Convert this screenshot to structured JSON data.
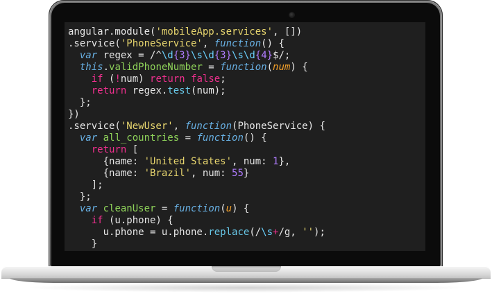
{
  "editor": {
    "lines": [
      [
        {
          "t": "angular.module(",
          "c": "default"
        },
        {
          "t": "'mobileApp.services'",
          "c": "string"
        },
        {
          "t": ", [])",
          "c": "default"
        }
      ],
      [
        {
          "t": ".service(",
          "c": "default"
        },
        {
          "t": "'PhoneService'",
          "c": "string"
        },
        {
          "t": ", ",
          "c": "default"
        },
        {
          "t": "function",
          "c": "storage"
        },
        {
          "t": "() {",
          "c": "default"
        }
      ],
      [
        {
          "t": "  ",
          "c": "default"
        },
        {
          "t": "var",
          "c": "storage"
        },
        {
          "t": " regex = /^",
          "c": "default"
        },
        {
          "t": "\\d",
          "c": "regex-escape"
        },
        {
          "t": "{3}",
          "c": "constant"
        },
        {
          "t": "\\s",
          "c": "regex-escape"
        },
        {
          "t": "\\d",
          "c": "regex-escape"
        },
        {
          "t": "{3}",
          "c": "constant"
        },
        {
          "t": "\\s",
          "c": "regex-escape"
        },
        {
          "t": "\\d",
          "c": "regex-escape"
        },
        {
          "t": "{4}",
          "c": "constant"
        },
        {
          "t": "$/;",
          "c": "default"
        }
      ],
      [
        {
          "t": "  ",
          "c": "default"
        },
        {
          "t": "this",
          "c": "storage"
        },
        {
          "t": ".",
          "c": "default"
        },
        {
          "t": "validPhoneNumber",
          "c": "function-name"
        },
        {
          "t": " = ",
          "c": "default"
        },
        {
          "t": "function",
          "c": "storage"
        },
        {
          "t": "(",
          "c": "default"
        },
        {
          "t": "num",
          "c": "param"
        },
        {
          "t": ") {",
          "c": "default"
        }
      ],
      [
        {
          "t": "    ",
          "c": "default"
        },
        {
          "t": "if",
          "c": "keyword"
        },
        {
          "t": " (",
          "c": "default"
        },
        {
          "t": "!",
          "c": "keyword"
        },
        {
          "t": "num) ",
          "c": "default"
        },
        {
          "t": "return",
          "c": "keyword"
        },
        {
          "t": " ",
          "c": "default"
        },
        {
          "t": "false",
          "c": "keyword"
        },
        {
          "t": ";",
          "c": "default"
        }
      ],
      [
        {
          "t": "    ",
          "c": "default"
        },
        {
          "t": "return",
          "c": "keyword"
        },
        {
          "t": " regex.",
          "c": "default"
        },
        {
          "t": "test",
          "c": "method"
        },
        {
          "t": "(num);",
          "c": "default"
        }
      ],
      [
        {
          "t": "  };",
          "c": "default"
        }
      ],
      [
        {
          "t": "})",
          "c": "default"
        }
      ],
      [
        {
          "t": ".service(",
          "c": "default"
        },
        {
          "t": "'NewUser'",
          "c": "string"
        },
        {
          "t": ", ",
          "c": "default"
        },
        {
          "t": "function",
          "c": "storage"
        },
        {
          "t": "(PhoneService) {",
          "c": "default"
        }
      ],
      [
        {
          "t": "  ",
          "c": "default"
        },
        {
          "t": "var",
          "c": "storage"
        },
        {
          "t": " ",
          "c": "default"
        },
        {
          "t": "all_countries",
          "c": "function-name"
        },
        {
          "t": " = ",
          "c": "default"
        },
        {
          "t": "function",
          "c": "storage"
        },
        {
          "t": "() {",
          "c": "default"
        }
      ],
      [
        {
          "t": "    ",
          "c": "default"
        },
        {
          "t": "return",
          "c": "keyword"
        },
        {
          "t": " [",
          "c": "default"
        }
      ],
      [
        {
          "t": "      {name: ",
          "c": "default"
        },
        {
          "t": "'United States'",
          "c": "string"
        },
        {
          "t": ", num: ",
          "c": "default"
        },
        {
          "t": "1",
          "c": "constant"
        },
        {
          "t": "},",
          "c": "default"
        }
      ],
      [
        {
          "t": "      {name: ",
          "c": "default"
        },
        {
          "t": "'Brazil'",
          "c": "string"
        },
        {
          "t": ", num: ",
          "c": "default"
        },
        {
          "t": "55",
          "c": "constant"
        },
        {
          "t": "}",
          "c": "default"
        }
      ],
      [
        {
          "t": "    ];",
          "c": "default"
        }
      ],
      [
        {
          "t": "  };",
          "c": "default"
        }
      ],
      [
        {
          "t": "  ",
          "c": "default"
        },
        {
          "t": "var",
          "c": "storage"
        },
        {
          "t": " ",
          "c": "default"
        },
        {
          "t": "cleanUser",
          "c": "function-name"
        },
        {
          "t": " = ",
          "c": "default"
        },
        {
          "t": "function",
          "c": "storage"
        },
        {
          "t": "(",
          "c": "default"
        },
        {
          "t": "u",
          "c": "param"
        },
        {
          "t": ") {",
          "c": "default"
        }
      ],
      [
        {
          "t": "    ",
          "c": "default"
        },
        {
          "t": "if",
          "c": "keyword"
        },
        {
          "t": " (u.phone) {",
          "c": "default"
        }
      ],
      [
        {
          "t": "      u.phone = u.phone.",
          "c": "default"
        },
        {
          "t": "replace",
          "c": "method"
        },
        {
          "t": "(/",
          "c": "default"
        },
        {
          "t": "\\s",
          "c": "regex-escape"
        },
        {
          "t": "+",
          "c": "keyword"
        },
        {
          "t": "/g, ",
          "c": "default"
        },
        {
          "t": "''",
          "c": "string"
        },
        {
          "t": ");",
          "c": "default"
        }
      ],
      [
        {
          "t": "    }",
          "c": "default"
        }
      ]
    ]
  },
  "colors": {
    "screen_bg": "#1f1f1f",
    "default": "#e6e6e6",
    "string": "#e7d56e",
    "keyword": "#f0308f",
    "storage": "#68b0e3",
    "param": "#f4a12a",
    "function_name": "#8fd35a",
    "method": "#68c8e8",
    "constant": "#b07cff",
    "regex_escape": "#6ad2ff"
  },
  "icons": {
    "camera": "camera-icon"
  }
}
